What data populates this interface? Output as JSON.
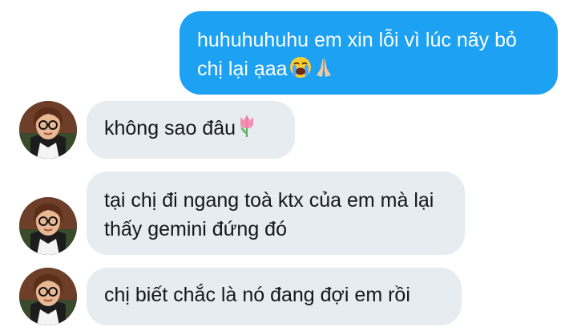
{
  "conversation": {
    "messages": [
      {
        "sender": "me",
        "text": "huhuhuhuhu em xin lỗi vì lúc nãy bỏ chị lại ạaa",
        "emojis": [
          "loudly-crying-face-emoji",
          "folded-hands-emoji"
        ]
      },
      {
        "sender": "other",
        "text": "không sao đâu",
        "emojis": [
          "tulip-emoji"
        ]
      },
      {
        "sender": "other",
        "text": "tại chị đi ngang toà ktx của em mà lại thấy gemini đứng đó",
        "emojis": []
      },
      {
        "sender": "other",
        "text": "chị biết chắc là nó đang đợi em rồi",
        "emojis": []
      }
    ]
  },
  "colors": {
    "sent_bubble": "#1da1f2",
    "received_bubble": "#e6ecf0",
    "received_text": "#14171a",
    "sent_text": "#ffffff"
  }
}
